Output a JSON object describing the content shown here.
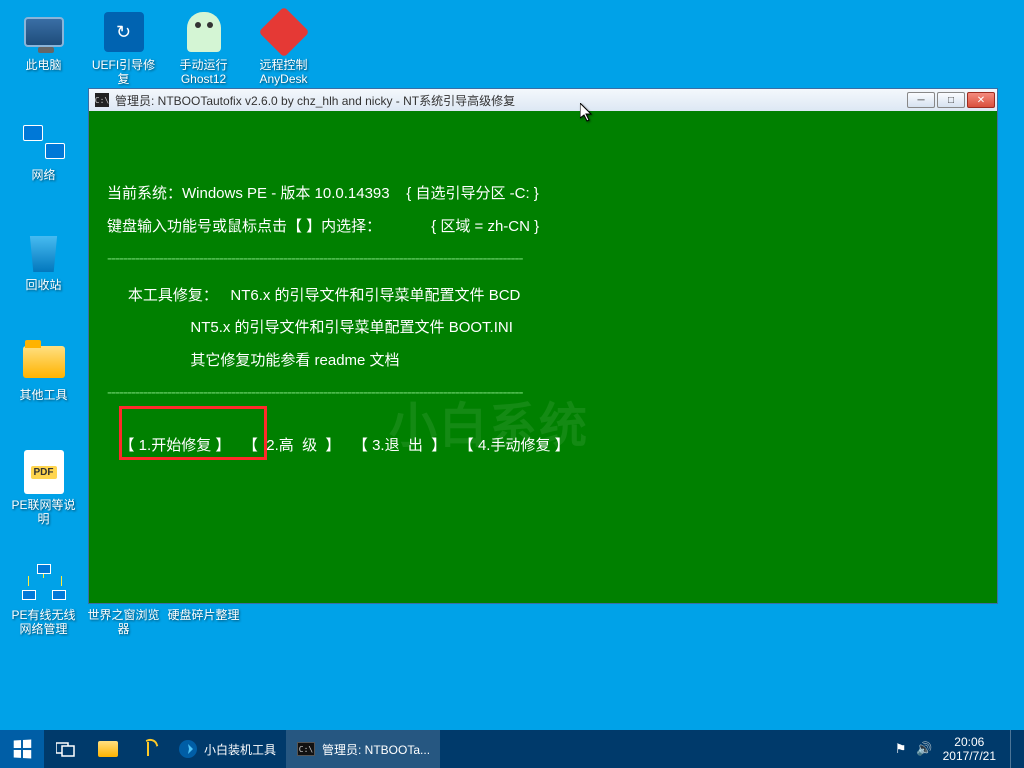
{
  "desktop_icons": {
    "this_pc": "此电脑",
    "uefi": "UEFI引导修复",
    "ghost": "手动运行Ghost12",
    "remote": "远程控制AnyDesk",
    "network": "网络",
    "recycle": "回收站",
    "other_tools": "其他工具",
    "pe_readme": "PE联网等说明",
    "pe_net_mgr": "PE有线无线网络管理",
    "browser": "世界之窗浏览器",
    "defrag": "硬盘碎片整理"
  },
  "window": {
    "title": "管理员: NTBOOTautofix v2.6.0 by chz_hlh and nicky - NT系统引导高级修复",
    "line_system": "当前系统：Windows PE - 版本 10.0.14393    { 自选引导分区 -C: }",
    "line_keyboard": "键盘输入功能号或鼠标点击【 】内选择：            { 区域 = zh-CN }",
    "tool_label": "本工具修复：",
    "tool_nt6": "NT6.x 的引导文件和引导菜单配置文件 BCD",
    "tool_nt5": "NT5.x 的引导文件和引导菜单配置文件 BOOT.INI",
    "tool_other": "其它修复功能参看 readme 文档",
    "menu1": "【 1.开始修复 】",
    "menu2": "【  2.高  级  】",
    "menu3": "【 3.退  出  】",
    "menu4": "【 4.手动修复 】",
    "watermark": "小白系统",
    "btn_min": "─",
    "btn_max": "□",
    "btn_close": "✕"
  },
  "taskbar": {
    "tool": "小白装机工具",
    "active": "管理员: NTBOOTa...",
    "tray_flag": "⚑",
    "tray_vol": "🔊",
    "time": "20:06",
    "date": "2017/7/21"
  }
}
